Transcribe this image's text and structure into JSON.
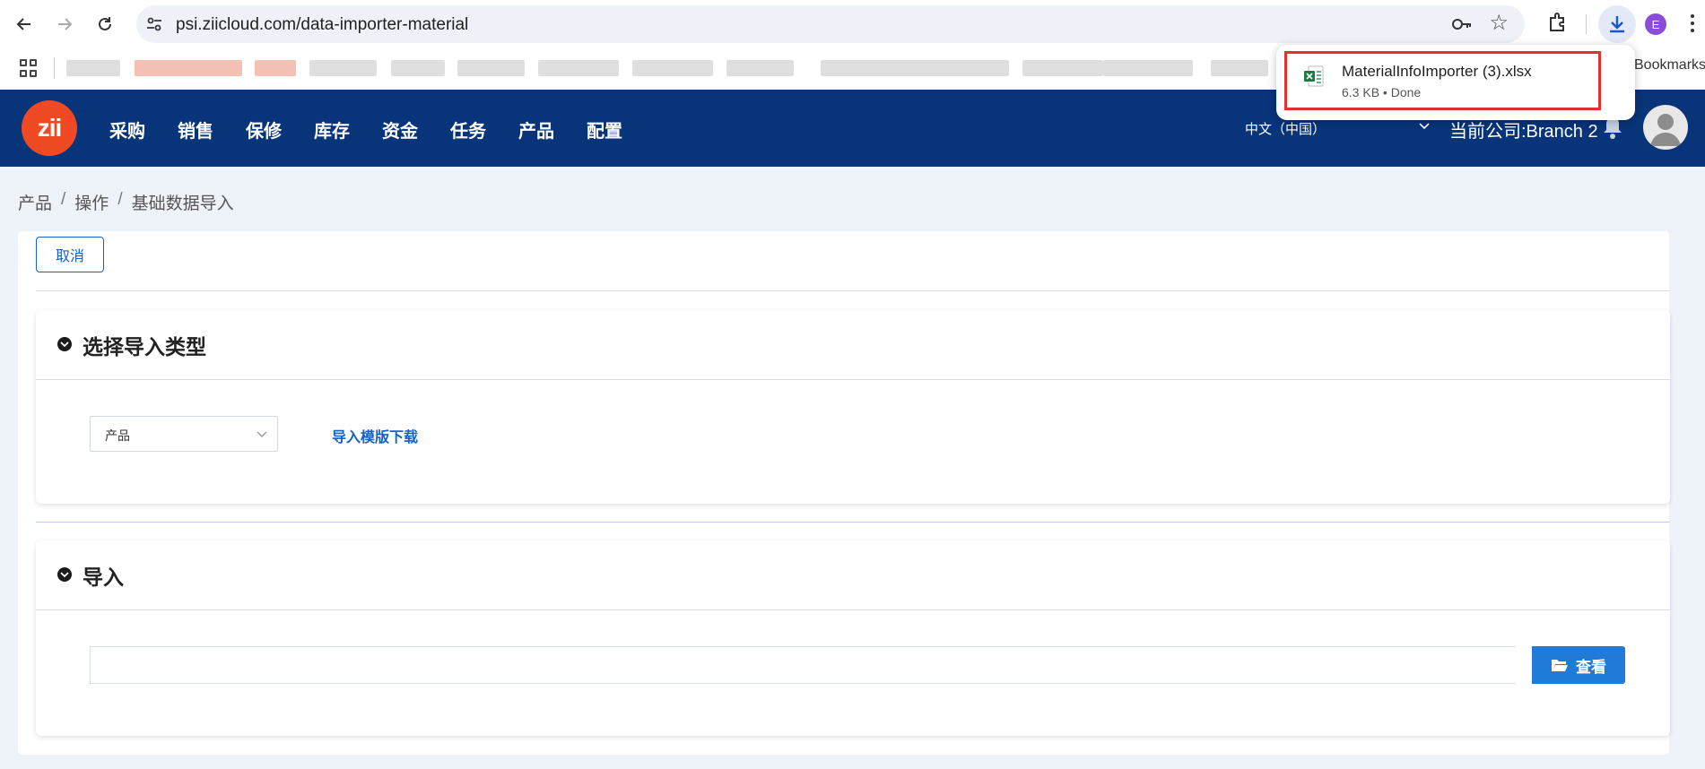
{
  "browser": {
    "url": "psi.ziicloud.com/data-importer-material",
    "profile_initial": "E",
    "bookmarks_label": "Bookmarks"
  },
  "downloads": {
    "file_name": "MaterialInfoImporter (3).xlsx",
    "file_meta": "6.3 KB • Done"
  },
  "header": {
    "logo_text": "zii",
    "menu": [
      "采购",
      "销售",
      "保修",
      "库存",
      "资金",
      "任务",
      "产品",
      "配置"
    ],
    "language": "中文（中国）",
    "company": "当前公司:Branch 2"
  },
  "breadcrumb": [
    "产品",
    "操作",
    "基础数据导入"
  ],
  "breadcrumb_separator": "/",
  "toolbar": {
    "cancel_label": "取消"
  },
  "type_section": {
    "title": "选择导入类型",
    "select_value": "产品",
    "template_link": "导入模版下载"
  },
  "import_section": {
    "title": "导入",
    "file_value": "",
    "browse_label": "查看"
  },
  "colors": {
    "header_bg": "#083479",
    "logo": "#f04a24",
    "accent": "#1561c8",
    "highlight": "#e0322c"
  }
}
